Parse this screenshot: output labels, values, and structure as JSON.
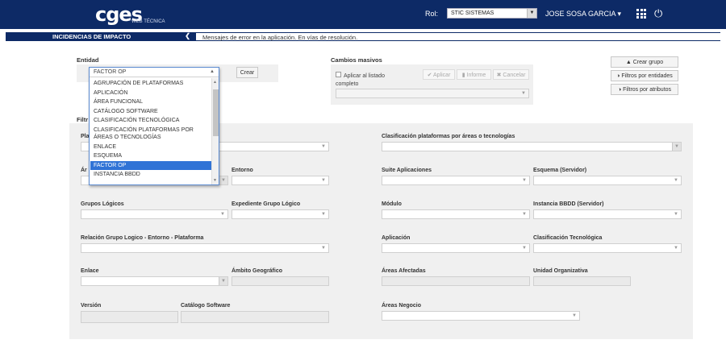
{
  "header": {
    "logo": "cges",
    "logo_sub": "WEB TÉCNICA",
    "rol_label": "Rol:",
    "rol_value": "STIC SISTEMAS",
    "user": "JOSE SOSA GARCIA ▾"
  },
  "subheader": {
    "title": "INCIDENCIAS DE IMPACTO",
    "description": "Mensajes de error en la aplicación. En vías de resolución."
  },
  "entidad": {
    "title": "Entidad",
    "create_label": "Crear",
    "selected": "FACTOR OP",
    "options": [
      "AGRUPACIÓN DE PLATAFORMAS",
      "APLICACIÓN",
      "ÁREA FUNCIONAL",
      "CATÁLOGO SOFTWARE",
      "CLASIFICACIÓN TECNOLÓGICA",
      "CLASIFICACIÓN PLATAFORMAS POR ÁREAS O TECNOLOGÍAS",
      "ENLACE",
      "ESQUEMA",
      "FACTOR OP",
      "INSTANCIA BBDD"
    ]
  },
  "cambios": {
    "title": "Cambios masivos",
    "checkbox_label": "Aplicar al listado completo",
    "aplicar": "✔ Aplicar",
    "informe": "▮ Informe",
    "cancelar": "✖ Cancelar"
  },
  "side_buttons": {
    "crear_grupo": "▲ Crear grupo",
    "filtros_entidades": "◑ Filtros por entidades",
    "filtros_atributos": "◑ Filtros por atributos"
  },
  "filters": {
    "title": "Filtr",
    "plataforma": "Pla",
    "clasif_plataformas": "Clasificación plataformas por áreas o tecnologías",
    "area": "Ár",
    "entorno": "Entorno",
    "suite": "Suite Aplicaciones",
    "esquema": "Esquema (Servidor)",
    "grupos": "Grupos Lógicos",
    "expediente": "Expediente Grupo Lógico",
    "modulo": "Módulo",
    "instancia": "Instancia BBDD (Servidor)",
    "relacion": "Relación Grupo Logico - Entorno - Plataforma",
    "aplicacion": "Aplicación",
    "clasif_tecnologica": "Clasificación Tecnológica",
    "enlace": "Enlace",
    "ambito": "Ámbito Geográfico",
    "areas_afectadas": "Áreas Afectadas",
    "unidad": "Unidad Organizativa",
    "version": "Versión",
    "catalogo": "Catálogo Software",
    "areas_negocio": "Áreas Negocio"
  }
}
